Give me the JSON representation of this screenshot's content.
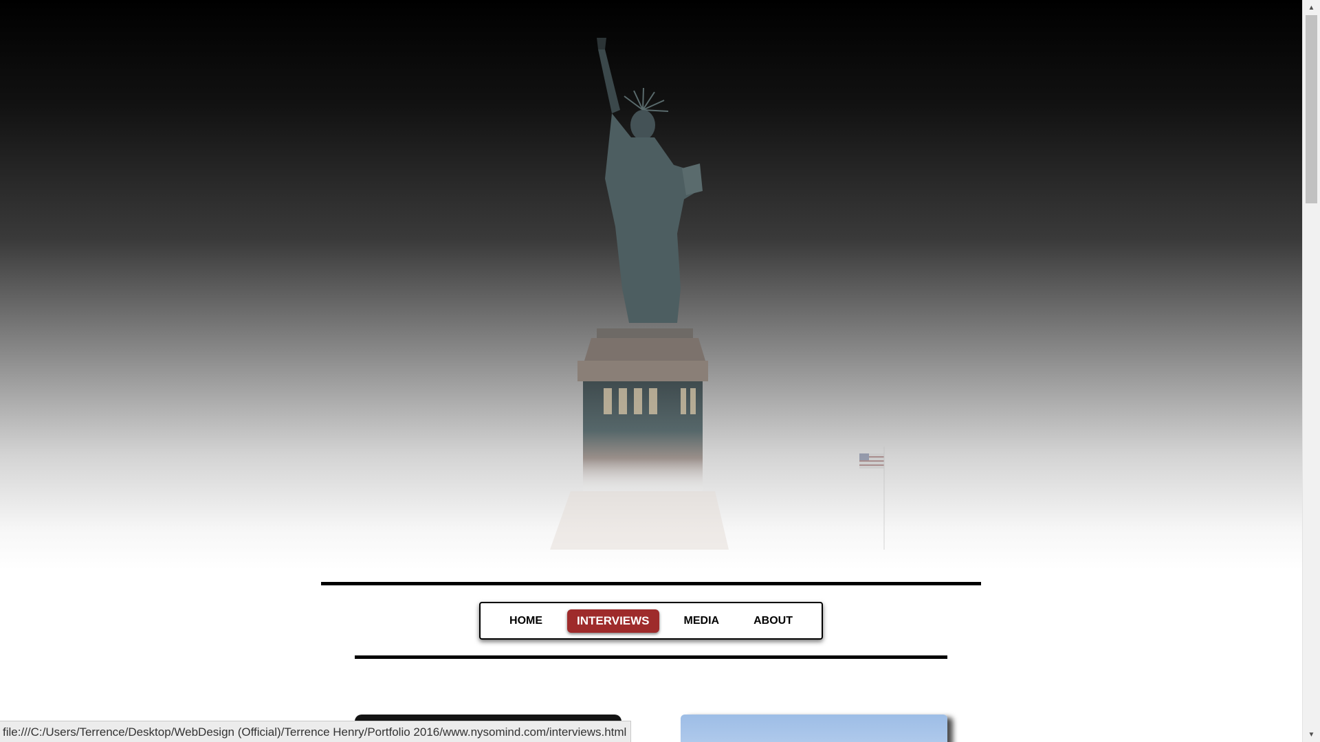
{
  "nav": {
    "items": [
      {
        "label": "HOME",
        "active": false
      },
      {
        "label": "INTERVIEWS",
        "active": true
      },
      {
        "label": "MEDIA",
        "active": false
      },
      {
        "label": "ABOUT",
        "active": false
      }
    ]
  },
  "status_bar": {
    "url": "file:///C:/Users/Terrence/Desktop/WebDesign  (Official)/Terrence Henry/Portfolio 2016/www.nysomind.com/interviews.html"
  },
  "colors": {
    "active_nav": "#9e2b2b",
    "rule": "#000000"
  },
  "icons": {
    "scroll_up": "triangle-up-icon",
    "scroll_down": "triangle-down-icon"
  }
}
